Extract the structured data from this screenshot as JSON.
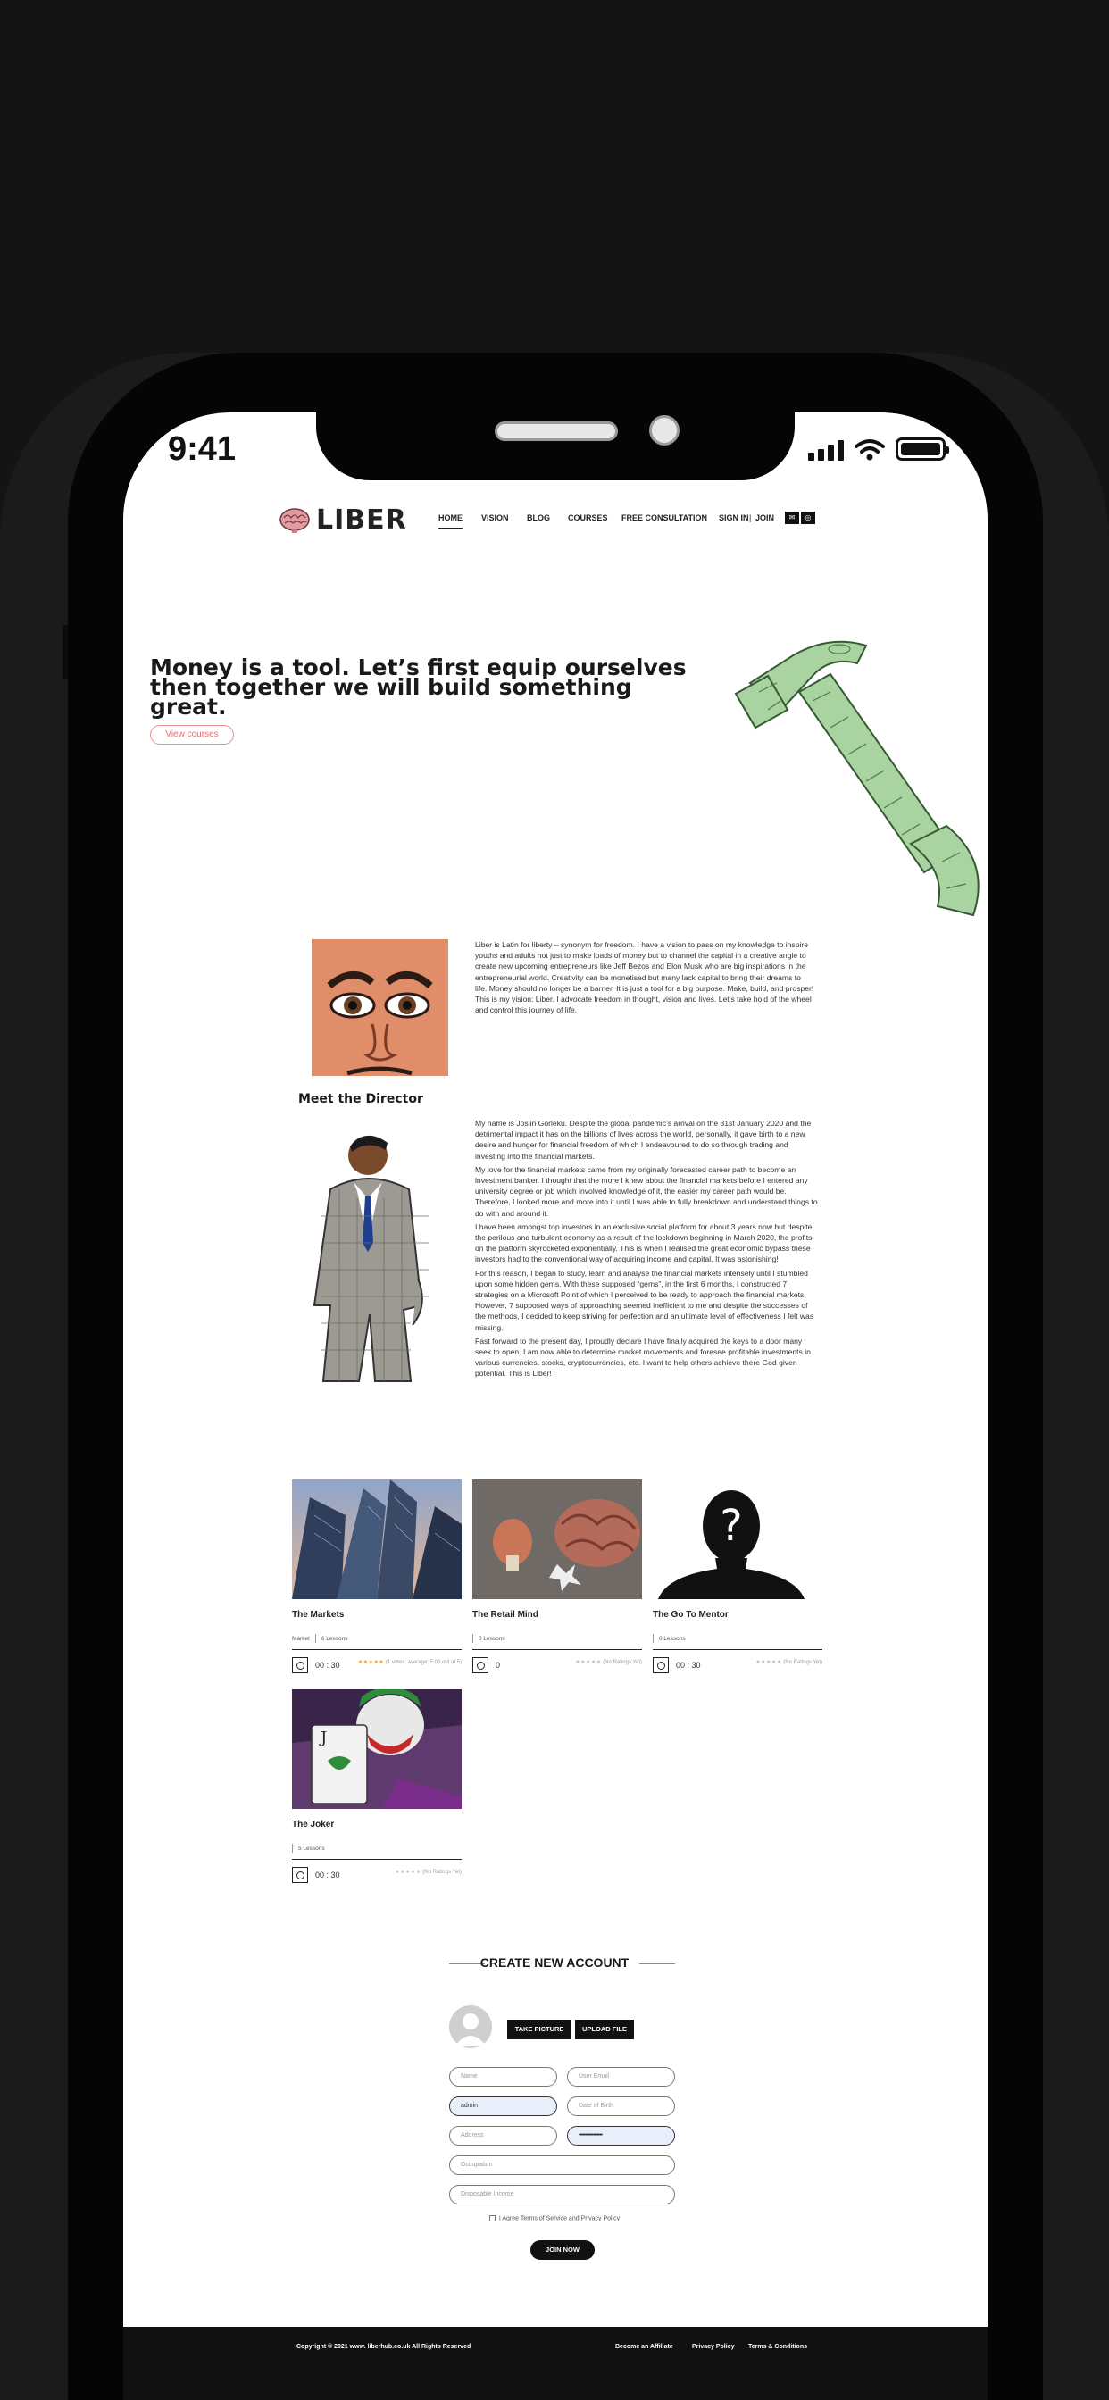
{
  "status_bar": {
    "time": "9:41"
  },
  "nav": {
    "logo_text": "LIBER",
    "links": [
      "HOME",
      "VISION",
      "BLOG",
      "COURSES",
      "FREE CONSULTATION"
    ],
    "sign_in": "SIGN IN",
    "separator": "|",
    "join": "JOIN"
  },
  "hero": {
    "title": "Money is a tool. Let’s first equip ourselves then together we will build something great.",
    "cta": "View courses"
  },
  "about": {
    "paragraph": "Liber is Latin for liberty – synonym for freedom. I have a vision to pass on my knowledge to inspire youths and adults not just to make loads of money but to channel the capital in a creative angle to create new upcoming entrepreneurs like Jeff Bezos and Elon Musk who are big inspirations in the entrepreneurial world. Creativity can be monetised but many lack capital to bring their dreams to life. Money should no longer be a barrier. It is just a tool for a big purpose. Make, build, and prosper! This is my vision: Liber. I advocate freedom in thought, vision and lives. Let’s take hold of the wheel and control this journey of life."
  },
  "director": {
    "heading": "Meet the Director",
    "paragraphs": [
      "My name is Joslin Gorleku. Despite the global pandemic’s arrival on the 31st January 2020 and the detrimental impact it has on the billions of lives across the world, personally, it gave birth to a new desire and hunger for financial freedom of which I endeavoured to do so through trading and investing into the financial markets.",
      "My love for the financial markets came from my originally forecasted career path to become an investment banker. I thought that the more I knew about the financial markets before I entered any university degree or job which involved knowledge of it, the easier my career path would be. Therefore, I looked more and more into it until I was able to fully breakdown and understand things to do with and around it.",
      "I have been amongst top investors in an exclusive social platform for about 3 years now but despite the perilous and turbulent economy as a result of the lockdown beginning in March 2020, the profits on the platform skyrocketed exponentially. This is when I realised the great economic bypass these investors had to the conventional way of acquiring income and capital. It was astonishing!",
      "For this reason, I began to study, learn and analyse the financial markets intensely until I stumbled upon some hidden gems. With these supposed “gems”, in the first 6 months, I constructed 7 strategies on a Microsoft Point of which I perceived to be ready to approach the financial markets. However, 7 supposed ways of approaching seemed inefficient to me and despite the successes of the methods, I decided to keep striving for perfection and an ultimate level of effectiveness I felt was missing.",
      "Fast forward to the present day, I proudly declare I have finally acquired the keys to a door many seek to open. I am now able to determine market movements and foresee profitable investments in various currencies, stocks, cryptocurrencies, etc. I want to help others achieve there God given potential. This is Liber!"
    ]
  },
  "courses": [
    {
      "title": "The Markets",
      "category": "Market",
      "lessons": "6 Lessons",
      "duration": "00 : 30",
      "rating_text": "(1 votes, average: 5.00 out of 5)",
      "stars": 5
    },
    {
      "title": "The Retail Mind",
      "category": "",
      "lessons": "0 Lessons",
      "duration": "0",
      "rating_text": "(No Ratings Yet)",
      "stars": 0
    },
    {
      "title": "The Go To Mentor",
      "category": "",
      "lessons": "0 Lessons",
      "duration": "00 : 30",
      "rating_text": "(No Ratings Yet)",
      "stars": 0
    },
    {
      "title": "The Joker",
      "category": "",
      "lessons": "5 Lessons",
      "duration": "00 : 30",
      "rating_text": "(No Ratings Yet)",
      "stars": 0
    }
  ],
  "account": {
    "heading": "CREATE NEW ACCOUNT",
    "take_picture": "TAKE PICTURE",
    "upload_file": "UPLOAD FILE",
    "fields": {
      "name_placeholder": "Name",
      "email_placeholder": "User Email",
      "username_value": "admin",
      "dob_placeholder": "Date of Birth",
      "address_placeholder": "Address",
      "password_value": "••••••••••••••••••",
      "occupation_placeholder": "Occupation",
      "income_placeholder": "Disposable Income"
    },
    "terms": "I Agree Terms of Service and Privacy Policy",
    "join_button": "JOIN NOW"
  },
  "footer": {
    "copyright": "Copyright © 2021 www. liberhub.co.uk All Rights Reserved",
    "links": [
      "Become an Affiliate",
      "Privacy Policy",
      "Terms & Conditions"
    ]
  },
  "colors": {
    "accent": "#e06f6f",
    "phone_bezel": "#050505",
    "background": "#8da487",
    "dark": "#111111"
  }
}
